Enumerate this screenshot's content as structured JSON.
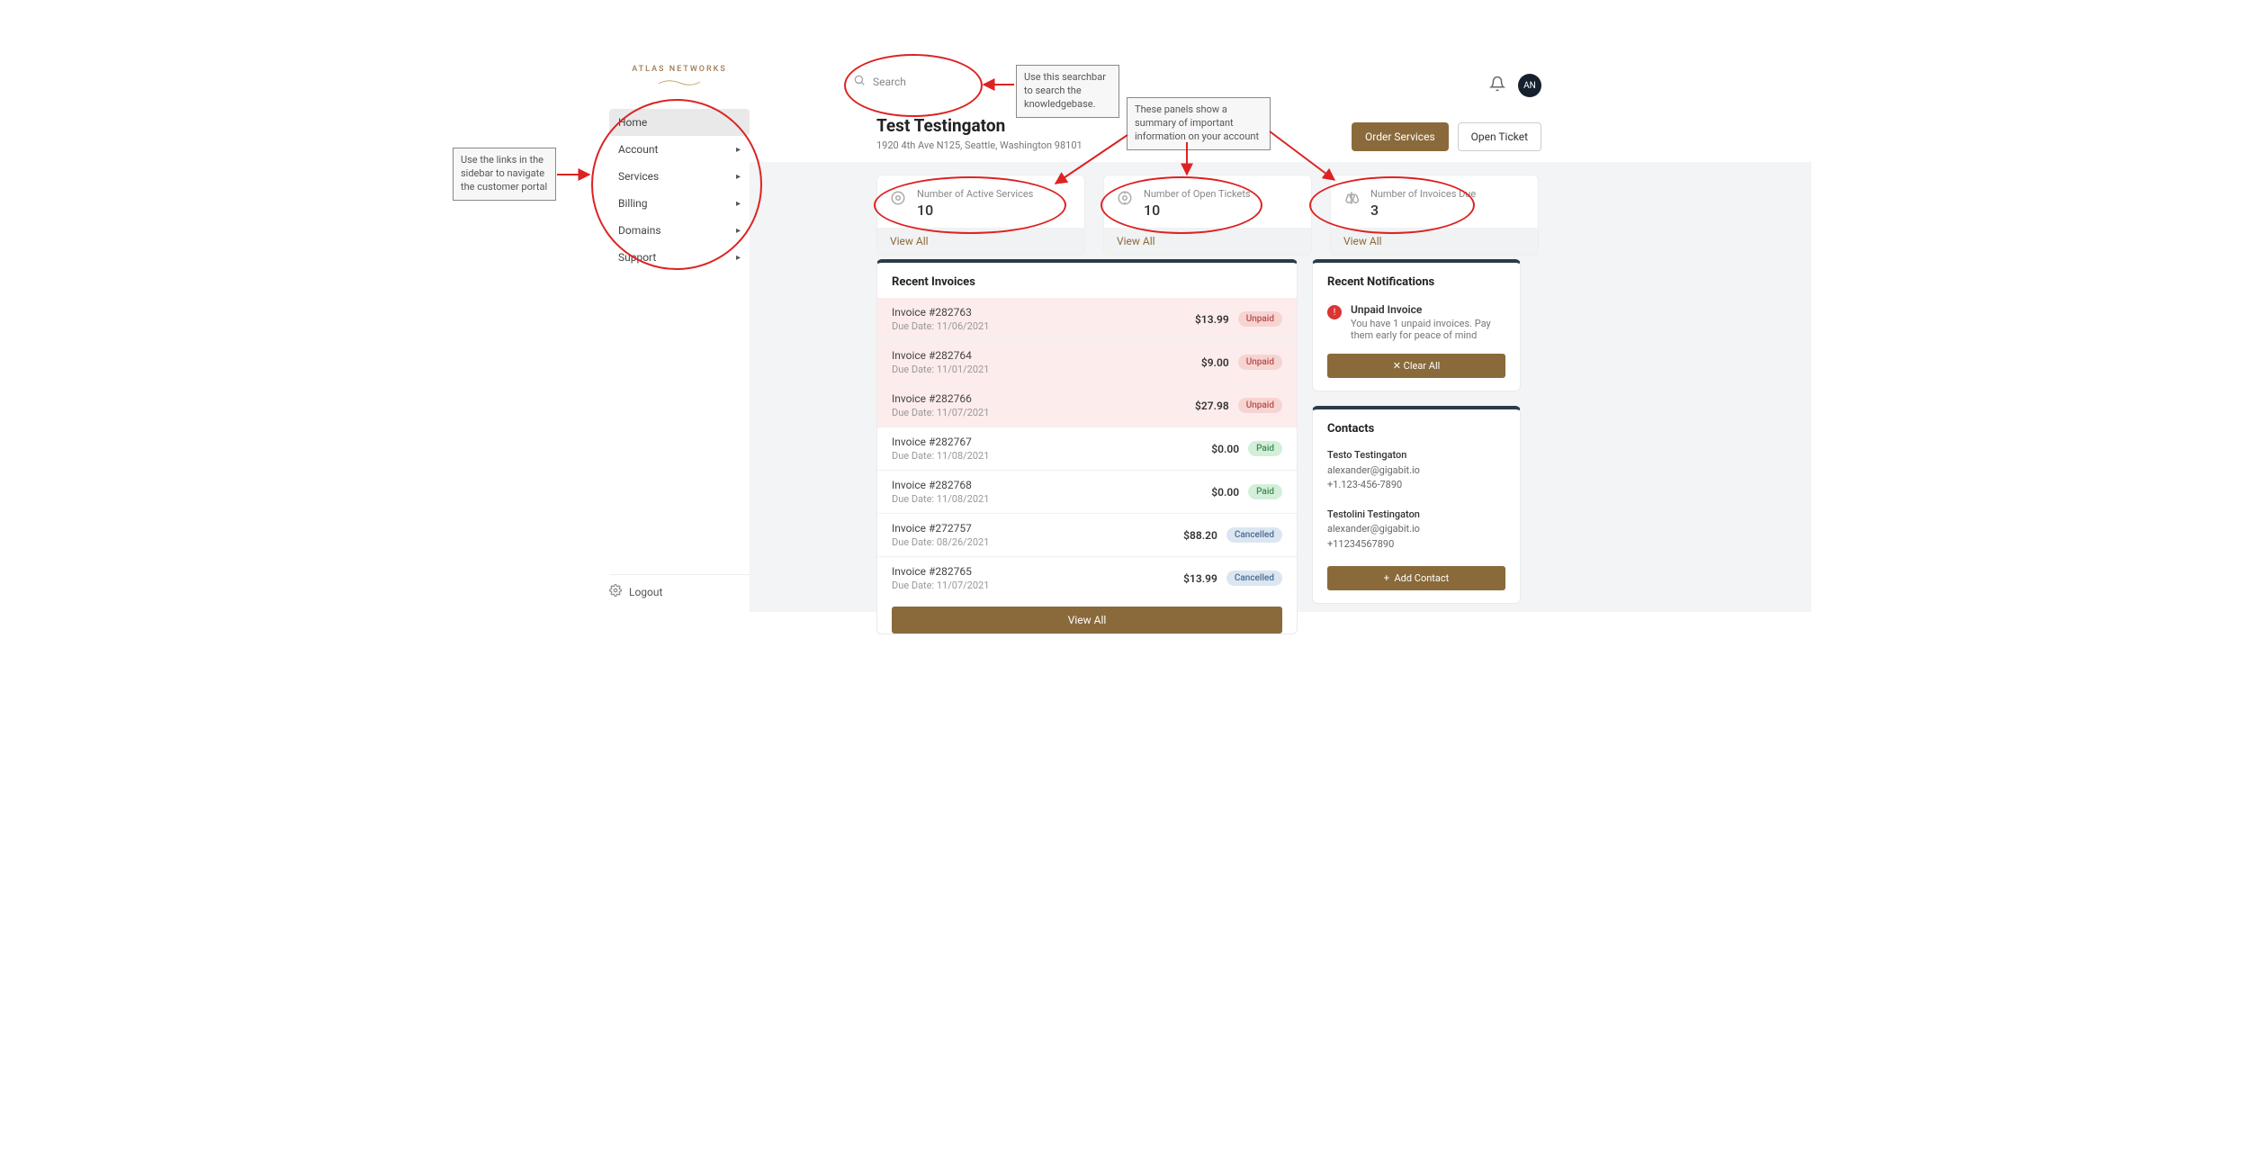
{
  "brand": {
    "name": "ATLAS NETWORKS"
  },
  "sidebar": {
    "items": [
      {
        "label": "Home",
        "expandable": false,
        "active": true
      },
      {
        "label": "Account",
        "expandable": true
      },
      {
        "label": "Services",
        "expandable": true
      },
      {
        "label": "Billing",
        "expandable": true
      },
      {
        "label": "Domains",
        "expandable": true
      },
      {
        "label": "Support",
        "expandable": true
      }
    ],
    "logout_label": "Logout"
  },
  "search": {
    "placeholder": "Search"
  },
  "avatar_initials": "AN",
  "customer": {
    "name": "Test Testingaton",
    "address": "1920 4th Ave N125, Seattle, Washington 98101"
  },
  "header_buttons": {
    "order": "Order Services",
    "ticket": "Open Ticket"
  },
  "summary": [
    {
      "label": "Number of Active Services",
      "value": "10",
      "link": "View All"
    },
    {
      "label": "Number of Open Tickets",
      "value": "10",
      "link": "View All"
    },
    {
      "label": "Number of Invoices Due",
      "value": "3",
      "link": "View All"
    }
  ],
  "invoices_panel": {
    "title": "Recent Invoices",
    "view_all": "View All",
    "rows": [
      {
        "name": "Invoice #282763",
        "due": "Due Date: 11/06/2021",
        "amount": "$13.99",
        "status": "Unpaid",
        "status_class": "unpaid"
      },
      {
        "name": "Invoice #282764",
        "due": "Due Date: 11/01/2021",
        "amount": "$9.00",
        "status": "Unpaid",
        "status_class": "unpaid"
      },
      {
        "name": "Invoice #282766",
        "due": "Due Date: 11/07/2021",
        "amount": "$27.98",
        "status": "Unpaid",
        "status_class": "unpaid"
      },
      {
        "name": "Invoice #282767",
        "due": "Due Date: 11/08/2021",
        "amount": "$0.00",
        "status": "Paid",
        "status_class": "paid"
      },
      {
        "name": "Invoice #282768",
        "due": "Due Date: 11/08/2021",
        "amount": "$0.00",
        "status": "Paid",
        "status_class": "paid"
      },
      {
        "name": "Invoice #272757",
        "due": "Due Date: 08/26/2021",
        "amount": "$88.20",
        "status": "Cancelled",
        "status_class": "cancelled"
      },
      {
        "name": "Invoice #282765",
        "due": "Due Date: 11/07/2021",
        "amount": "$13.99",
        "status": "Cancelled",
        "status_class": "cancelled"
      }
    ]
  },
  "notifications_panel": {
    "title": "Recent Notifications",
    "items": [
      {
        "title": "Unpaid Invoice",
        "body": "You have 1 unpaid invoices. Pay them early for peace of mind"
      }
    ],
    "clear_label": "Clear All"
  },
  "contacts_panel": {
    "title": "Contacts",
    "contacts": [
      {
        "name": "Testo Testingaton",
        "email": "alexander@gigabit.io",
        "phone": "+1.123-456-7890"
      },
      {
        "name": "Testolini Testingaton",
        "email": "alexander@gigabit.io",
        "phone": "+11234567890"
      }
    ],
    "add_label": "Add Contact"
  },
  "annotations": {
    "sidebar_note": "Use the links in the sidebar to navigate the customer portal",
    "search_note": "Use this searchbar to search the knowledgebase.",
    "panels_note": "These panels show a summary of important information on your account"
  }
}
